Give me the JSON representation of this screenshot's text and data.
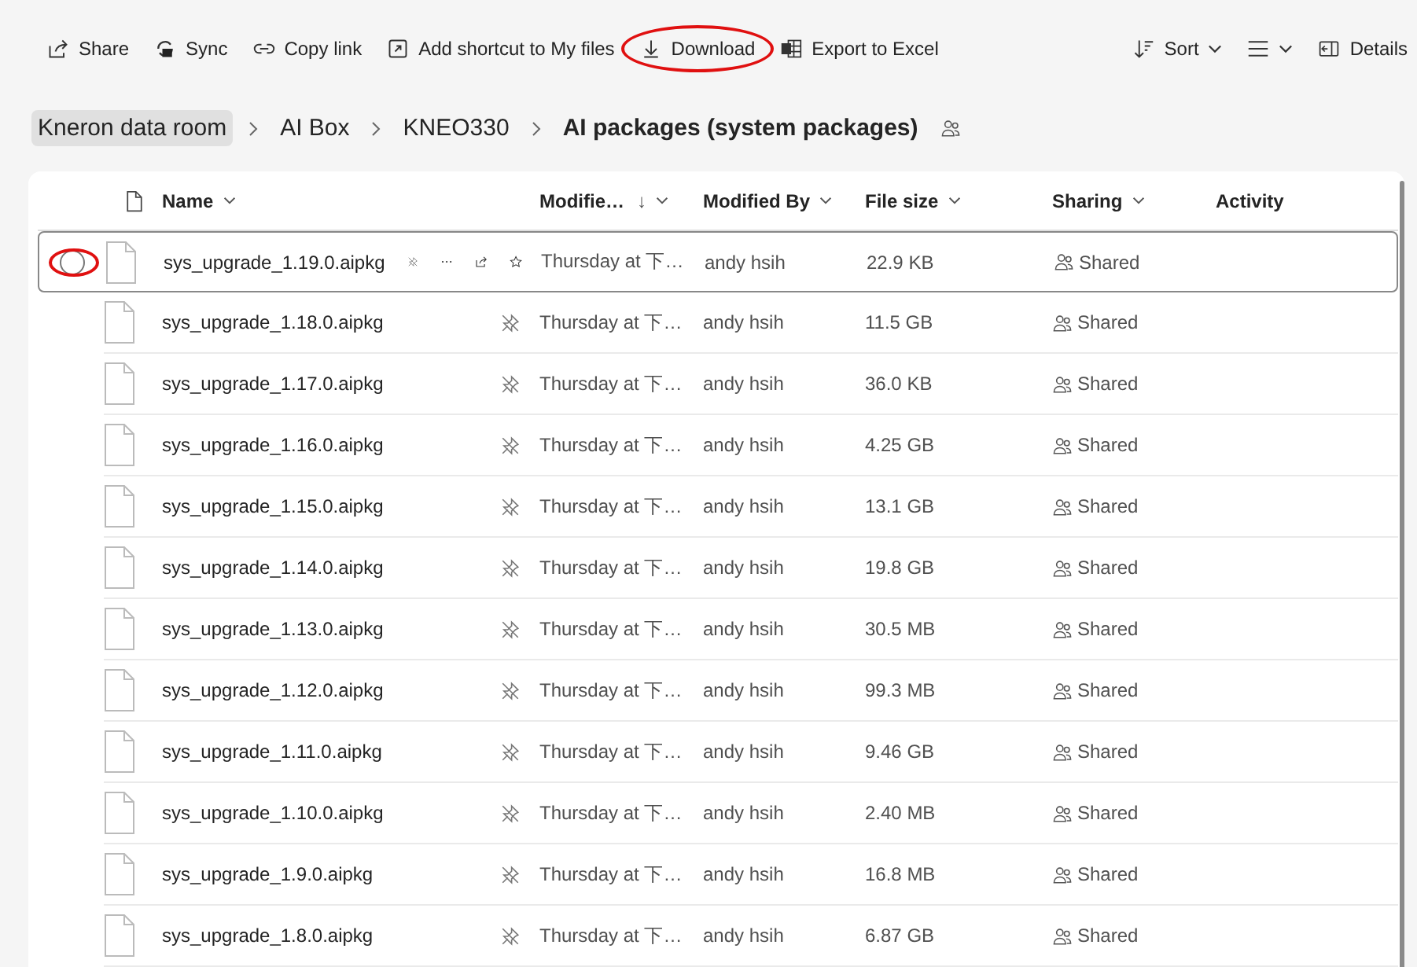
{
  "toolbar": {
    "left": [
      {
        "kind": "share",
        "label": "Share",
        "circled": false
      },
      {
        "kind": "sync",
        "label": "Sync",
        "circled": false
      },
      {
        "kind": "link",
        "label": "Copy link",
        "circled": false
      },
      {
        "kind": "shortcut",
        "label": "Add shortcut to My files",
        "circled": false
      },
      {
        "kind": "download",
        "label": "Download",
        "circled": true
      },
      {
        "kind": "excel",
        "label": "Export to Excel",
        "circled": false
      }
    ],
    "right": [
      {
        "kind": "sort",
        "label": "Sort",
        "caret": true
      },
      {
        "kind": "view",
        "caret": true
      },
      {
        "kind": "details",
        "label": "Details",
        "caret": false
      }
    ]
  },
  "breadcrumb": [
    {
      "label": "Kneron data room",
      "current": false,
      "highlighted": true
    },
    {
      "label": "AI Box",
      "current": false,
      "highlighted": false
    },
    {
      "label": "KNEO330",
      "current": false,
      "highlighted": false
    },
    {
      "label": "AI packages (system packages)",
      "current": true,
      "highlighted": false
    }
  ],
  "table": {
    "columns": [
      {
        "label": "Name",
        "caret": true
      },
      {
        "label": "Modifie…",
        "caret": true,
        "sort": "↓"
      },
      {
        "label": "Modified By",
        "caret": true
      },
      {
        "label": "File size",
        "caret": true
      },
      {
        "label": "Sharing",
        "caret": true
      },
      {
        "label": "Activity",
        "caret": false
      }
    ],
    "rows": [
      {
        "name": "sys_upgrade_1.19.0.aipkg",
        "modified": "Thursday at 下…",
        "modified_by": "andy hsih",
        "size": "22.9 KB",
        "sharing": "Shared",
        "hovered": true,
        "circled": true
      },
      {
        "name": "sys_upgrade_1.18.0.aipkg",
        "modified": "Thursday at 下…",
        "modified_by": "andy hsih",
        "size": "11.5 GB",
        "sharing": "Shared",
        "hovered": false,
        "circled": false
      },
      {
        "name": "sys_upgrade_1.17.0.aipkg",
        "modified": "Thursday at 下…",
        "modified_by": "andy hsih",
        "size": "36.0 KB",
        "sharing": "Shared",
        "hovered": false,
        "circled": false
      },
      {
        "name": "sys_upgrade_1.16.0.aipkg",
        "modified": "Thursday at 下…",
        "modified_by": "andy hsih",
        "size": "4.25 GB",
        "sharing": "Shared",
        "hovered": false,
        "circled": false
      },
      {
        "name": "sys_upgrade_1.15.0.aipkg",
        "modified": "Thursday at 下…",
        "modified_by": "andy hsih",
        "size": "13.1 GB",
        "sharing": "Shared",
        "hovered": false,
        "circled": false
      },
      {
        "name": "sys_upgrade_1.14.0.aipkg",
        "modified": "Thursday at 下…",
        "modified_by": "andy hsih",
        "size": "19.8 GB",
        "sharing": "Shared",
        "hovered": false,
        "circled": false
      },
      {
        "name": "sys_upgrade_1.13.0.aipkg",
        "modified": "Thursday at 下…",
        "modified_by": "andy hsih",
        "size": "30.5 MB",
        "sharing": "Shared",
        "hovered": false,
        "circled": false
      },
      {
        "name": "sys_upgrade_1.12.0.aipkg",
        "modified": "Thursday at 下…",
        "modified_by": "andy hsih",
        "size": "99.3 MB",
        "sharing": "Shared",
        "hovered": false,
        "circled": false
      },
      {
        "name": "sys_upgrade_1.11.0.aipkg",
        "modified": "Thursday at 下…",
        "modified_by": "andy hsih",
        "size": "9.46 GB",
        "sharing": "Shared",
        "hovered": false,
        "circled": false
      },
      {
        "name": "sys_upgrade_1.10.0.aipkg",
        "modified": "Thursday at 下…",
        "modified_by": "andy hsih",
        "size": "2.40 MB",
        "sharing": "Shared",
        "hovered": false,
        "circled": false
      },
      {
        "name": "sys_upgrade_1.9.0.aipkg",
        "modified": "Thursday at 下…",
        "modified_by": "andy hsih",
        "size": "16.8 MB",
        "sharing": "Shared",
        "hovered": false,
        "circled": false
      },
      {
        "name": "sys_upgrade_1.8.0.aipkg",
        "modified": "Thursday at 下…",
        "modified_by": "andy hsih",
        "size": "6.87 GB",
        "sharing": "Shared",
        "hovered": false,
        "circled": false
      }
    ]
  }
}
